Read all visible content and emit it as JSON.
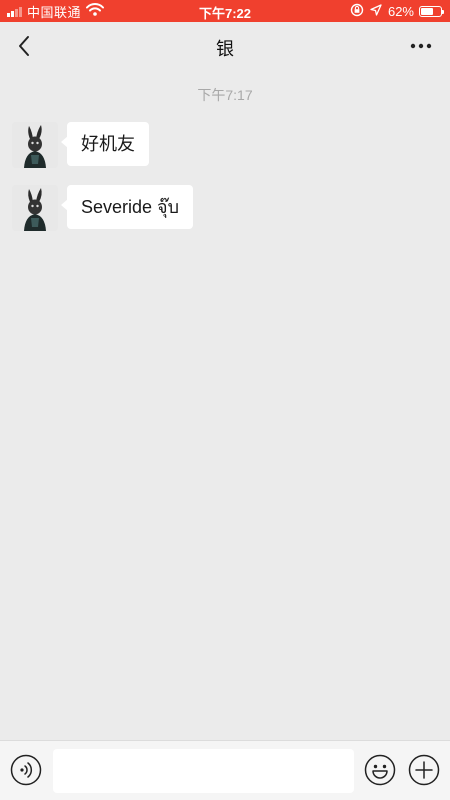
{
  "status_bar": {
    "carrier": "中国联通",
    "time": "下午7:22",
    "battery_percent": "62%",
    "battery_level": 0.62,
    "signal_bars": 2,
    "icons": [
      "signal-icon",
      "wifi-icon",
      "orientation-lock-icon",
      "location-arrow-icon",
      "battery-icon"
    ],
    "background": "#f0402e"
  },
  "nav": {
    "title": "银",
    "back_icon": "chevron-left-icon",
    "more_icon": "more-dots-icon"
  },
  "chat": {
    "background": "#ebebeb",
    "timestamp": "下午7:17",
    "messages": [
      {
        "sender": "incoming",
        "avatar": "bunny-avatar",
        "text": "好机友"
      },
      {
        "sender": "incoming",
        "avatar": "bunny-avatar",
        "text": "Severide จุ๊บ"
      }
    ]
  },
  "input_bar": {
    "placeholder": "",
    "value": "",
    "icons": [
      "voice-icon",
      "emoji-icon",
      "plus-icon"
    ]
  }
}
